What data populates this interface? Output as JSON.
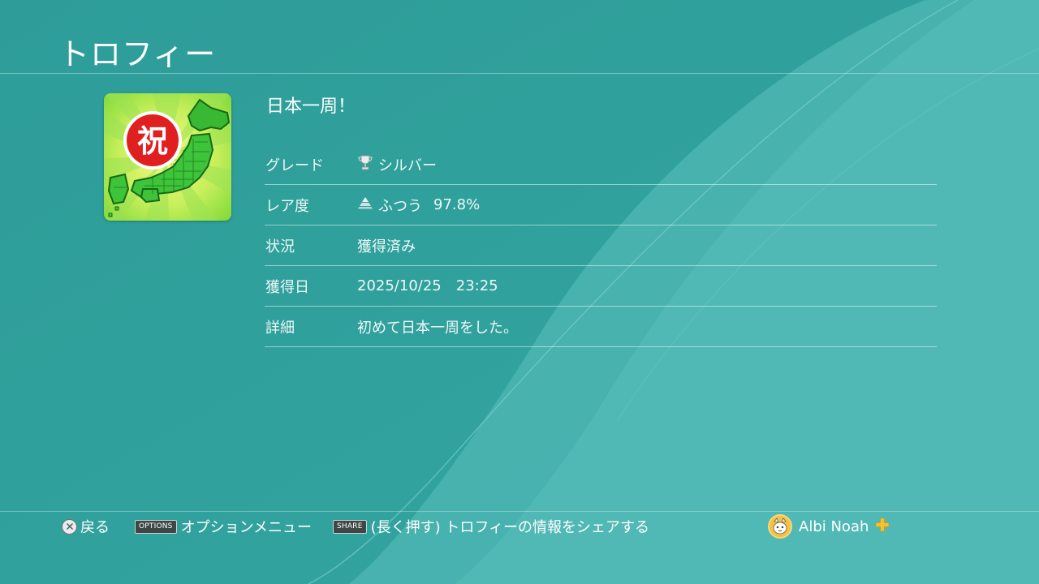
{
  "header": {
    "title": "トロフィー"
  },
  "trophy": {
    "name": "日本一周！",
    "icon_badge_text": "祝",
    "details": [
      {
        "label": "グレード",
        "value": "シルバー",
        "icon": "silver-trophy-icon"
      },
      {
        "label": "レア度",
        "value": "ふつう",
        "extra": "97.8%",
        "icon": "rarity-common-icon"
      },
      {
        "label": "状況",
        "value": "獲得済み"
      },
      {
        "label": "獲得日",
        "value": "2025/10/25",
        "extra": "23:25"
      },
      {
        "label": "詳細",
        "value": "初めて日本一周をした。"
      }
    ]
  },
  "footer": {
    "back_label": "戻る",
    "options_button": "OPTIONS",
    "options_label": "オプションメニュー",
    "share_button": "SHARE",
    "share_label": "(長く押す) トロフィーの情報をシェアする",
    "user_name": "Albi Noah"
  },
  "colors": {
    "background": "#2f9f9b",
    "accent_light": "#55bcb7",
    "icon_green": "#3ec43a",
    "badge_red": "#e02020",
    "plus_gold": "#f2c230"
  }
}
